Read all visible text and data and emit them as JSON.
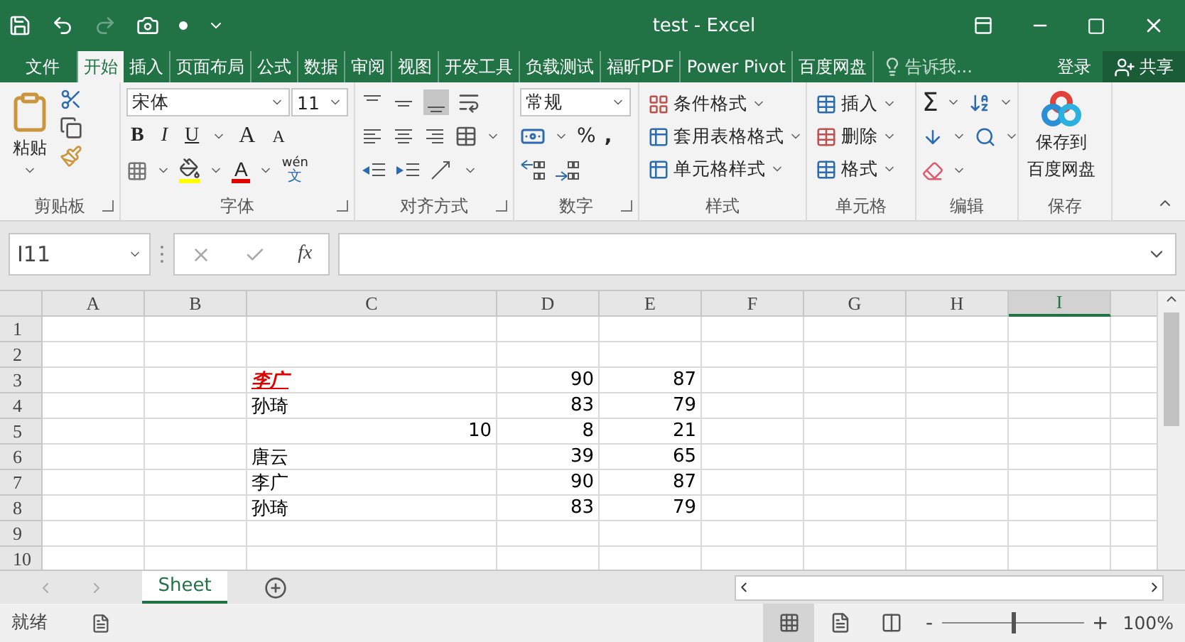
{
  "window": {
    "title": "test - Excel"
  },
  "ribbon_tabs": [
    {
      "label": "文件",
      "selected": false
    },
    {
      "label": "开始",
      "selected": true
    },
    {
      "label": "插入",
      "selected": false
    },
    {
      "label": "页面布局",
      "selected": false
    },
    {
      "label": "公式",
      "selected": false
    },
    {
      "label": "数据",
      "selected": false
    },
    {
      "label": "审阅",
      "selected": false
    },
    {
      "label": "视图",
      "selected": false
    },
    {
      "label": "开发工具",
      "selected": false
    },
    {
      "label": "负载测试",
      "selected": false
    },
    {
      "label": "福昕PDF",
      "selected": false
    },
    {
      "label": "Power Pivot",
      "selected": false
    },
    {
      "label": "百度网盘",
      "selected": false
    }
  ],
  "tell_me": {
    "placeholder": "告诉我..."
  },
  "sign_in": "登录",
  "share": "共享",
  "ribbon": {
    "clipboard": {
      "label": "剪贴板",
      "paste": "粘贴"
    },
    "font": {
      "label": "字体",
      "font_name": "宋体",
      "font_size": "11",
      "bold": "B",
      "italic": "I",
      "underline": "U",
      "grow": "A",
      "shrink": "A",
      "font_color": "A",
      "phonetic_top": "wén",
      "phonetic_bottom": "文"
    },
    "alignment": {
      "label": "对齐方式"
    },
    "number": {
      "label": "数字",
      "format": "常规",
      "percent": "%",
      "comma": ","
    },
    "styles": {
      "label": "样式",
      "items": [
        "条件格式",
        "套用表格格式",
        "单元格样式"
      ]
    },
    "cells": {
      "label": "单元格",
      "items": [
        "插入",
        "删除",
        "格式"
      ]
    },
    "editing": {
      "label": "编辑",
      "sum": "Σ"
    },
    "save": {
      "label": "保存",
      "button_line1": "保存到",
      "button_line2": "百度网盘"
    }
  },
  "formula_bar": {
    "name_box": "I11",
    "fx": "fx"
  },
  "sheet": {
    "columns": [
      {
        "label": "A",
        "selected": false
      },
      {
        "label": "B",
        "selected": false
      },
      {
        "label": "C",
        "selected": false
      },
      {
        "label": "D",
        "selected": false
      },
      {
        "label": "E",
        "selected": false
      },
      {
        "label": "F",
        "selected": false
      },
      {
        "label": "G",
        "selected": false
      },
      {
        "label": "H",
        "selected": false
      },
      {
        "label": "I",
        "selected": true
      }
    ],
    "rows": [
      {
        "label": "1"
      },
      {
        "label": "2"
      },
      {
        "label": "3",
        "cells": [
          null,
          null,
          {
            "text": "李广",
            "kind": "text",
            "emphasis": true
          },
          {
            "text": "90",
            "kind": "number"
          },
          {
            "text": "87",
            "kind": "number"
          },
          null,
          null,
          null,
          null
        ]
      },
      {
        "label": "4",
        "cells": [
          null,
          null,
          {
            "text": "孙琦",
            "kind": "text"
          },
          {
            "text": "83",
            "kind": "number"
          },
          {
            "text": "79",
            "kind": "number"
          },
          null,
          null,
          null,
          null
        ]
      },
      {
        "label": "5",
        "cells": [
          null,
          null,
          {
            "text": "10",
            "kind": "number"
          },
          {
            "text": "8",
            "kind": "number"
          },
          {
            "text": "21",
            "kind": "number"
          },
          null,
          null,
          null,
          null
        ]
      },
      {
        "label": "6",
        "cells": [
          null,
          null,
          {
            "text": "唐云",
            "kind": "text"
          },
          {
            "text": "39",
            "kind": "number"
          },
          {
            "text": "65",
            "kind": "number"
          },
          null,
          null,
          null,
          null
        ]
      },
      {
        "label": "7",
        "cells": [
          null,
          null,
          {
            "text": "李广",
            "kind": "text"
          },
          {
            "text": "90",
            "kind": "number"
          },
          {
            "text": "87",
            "kind": "number"
          },
          null,
          null,
          null,
          null
        ]
      },
      {
        "label": "8",
        "cells": [
          null,
          null,
          {
            "text": "孙琦",
            "kind": "text"
          },
          {
            "text": "83",
            "kind": "number"
          },
          {
            "text": "79",
            "kind": "number"
          },
          null,
          null,
          null,
          null
        ]
      },
      {
        "label": "9"
      },
      {
        "label": "10"
      }
    ]
  },
  "sheet_tabs": [
    {
      "label": "Sheet",
      "selected": true
    }
  ],
  "status_bar": {
    "status": "就绪",
    "zoom_minus": "-",
    "zoom_plus": "+",
    "zoom": "100%",
    "zoom_slider": {
      "level": 0.5
    }
  }
}
